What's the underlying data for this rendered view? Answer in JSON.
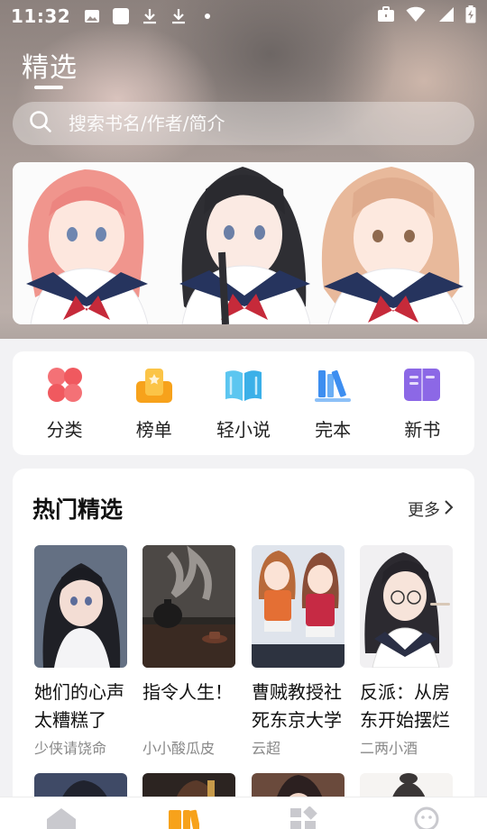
{
  "status_bar": {
    "time": "11:32"
  },
  "header": {
    "title": "精选"
  },
  "search": {
    "placeholder": "搜索书名/作者/简介"
  },
  "categories": [
    {
      "label": "分类",
      "icon": "four-petal-icon",
      "color": "#f0595f"
    },
    {
      "label": "榜单",
      "icon": "ranking-icon",
      "color": "#f7a21b"
    },
    {
      "label": "轻小说",
      "icon": "open-book-icon",
      "color": "#3bb0e8"
    },
    {
      "label": "完本",
      "icon": "bookshelf-icon",
      "color": "#3d8ef0"
    },
    {
      "label": "新书",
      "icon": "new-book-icon",
      "color": "#8c68e6"
    }
  ],
  "hot_section": {
    "title": "热门精选",
    "more_label": "更多",
    "books": [
      {
        "title": "她们的心声太糟糕了",
        "author": "少侠请饶命"
      },
      {
        "title": "指令人生！",
        "author": "小小酸瓜皮"
      },
      {
        "title": "曹贼教授社死东京大学",
        "author": "云超"
      },
      {
        "title": "反派：从房东开始摆烂",
        "author": "二两小酒"
      }
    ]
  },
  "bottom_nav": [
    {
      "icon": "home-icon",
      "active": false
    },
    {
      "icon": "bookshelf-icon",
      "active": true
    },
    {
      "icon": "grid-icon",
      "active": false
    },
    {
      "icon": "profile-icon",
      "active": false
    }
  ],
  "colors": {
    "accent": "#f7a21b",
    "background": "#f2f2f4"
  }
}
